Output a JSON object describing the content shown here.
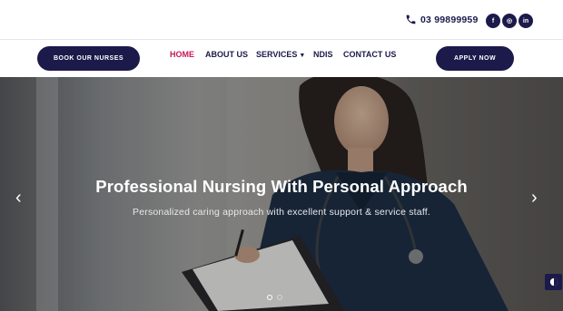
{
  "header": {
    "phone": "03 99899959",
    "socials": [
      {
        "label": "f",
        "icon": "facebook-icon"
      },
      {
        "label": "◎",
        "icon": "instagram-icon"
      },
      {
        "label": "in",
        "icon": "linkedin-icon"
      }
    ]
  },
  "nav": {
    "book_label": "BOOK OUR NURSES",
    "apply_label": "APPLY NOW",
    "items": [
      {
        "label": "HOME",
        "active": true
      },
      {
        "label": "ABOUT US"
      },
      {
        "label": "SERVICES"
      },
      {
        "label": "NDIS"
      },
      {
        "label": "CONTACT US"
      }
    ]
  },
  "hero": {
    "title": "Professional Nursing With Personal Approach",
    "subtitle": "Personalized caring approach with excellent support & service staff.",
    "prev_glyph": "‹",
    "next_glyph": "›",
    "slides_count": 2,
    "active_slide": 1
  },
  "colors": {
    "brand": "#1b1a4a",
    "accent": "#c8175a"
  }
}
